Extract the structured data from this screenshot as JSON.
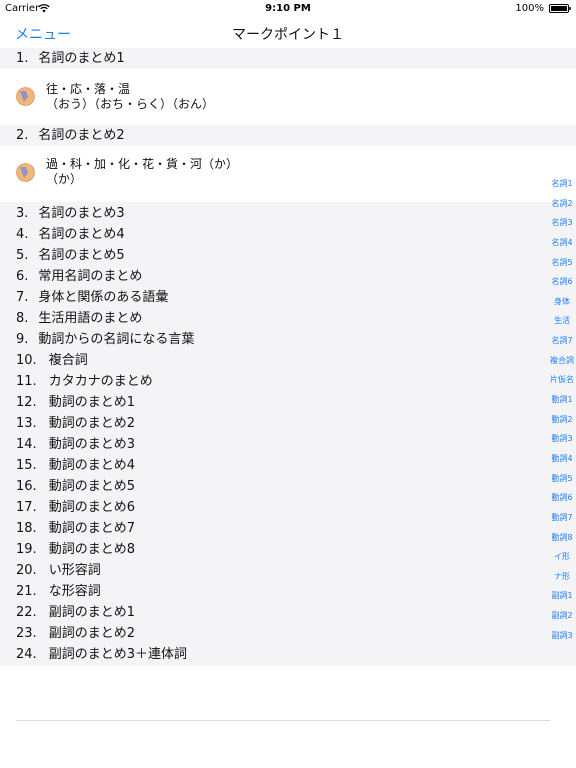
{
  "status_bar": {
    "carrier": "Carrier",
    "time": "9:10 PM",
    "battery_percent": "100%",
    "battery_level": 1.0
  },
  "nav": {
    "menu_label": "メニュー",
    "title": "マークポイント１"
  },
  "colors": {
    "accent": "#1a7ef5",
    "section_bg": "#f4f4f6",
    "icon": "#f2b57a",
    "icon_accent": "#8a8fcf"
  },
  "sections": [
    {
      "num": "1.",
      "title": "名詞のまとめ1",
      "rows": [
        {
          "icon": "bookmark-circle-icon",
          "line1": "往・応・落・温",
          "line2": "（おう）（おち・らく）（おん）"
        }
      ]
    },
    {
      "num": "2.",
      "title": "名詞のまとめ2",
      "rows": [
        {
          "icon": "bookmark-circle-icon",
          "line1": "過・科・加・化・花・貨・河（か）",
          "line2": "（か）"
        }
      ]
    },
    {
      "num": "3.",
      "title": "名詞のまとめ3"
    },
    {
      "num": "4.",
      "title": "名詞のまとめ4"
    },
    {
      "num": "5.",
      "title": "名詞のまとめ5"
    },
    {
      "num": "6.",
      "title": "常用名詞のまとめ"
    },
    {
      "num": "7.",
      "title": "身体と関係のある語彙"
    },
    {
      "num": "8.",
      "title": "生活用語のまとめ"
    },
    {
      "num": "9.",
      "title": "動詞からの名詞になる言葉"
    },
    {
      "num": "10.",
      "title": "複合詞"
    },
    {
      "num": "11.",
      "title": "カタカナのまとめ"
    },
    {
      "num": "12.",
      "title": "動詞のまとめ1"
    },
    {
      "num": "13.",
      "title": "動詞のまとめ2"
    },
    {
      "num": "14.",
      "title": "動詞のまとめ3"
    },
    {
      "num": "15.",
      "title": "動詞のまとめ4"
    },
    {
      "num": "16.",
      "title": "動詞のまとめ5"
    },
    {
      "num": "17.",
      "title": "動詞のまとめ6"
    },
    {
      "num": "18.",
      "title": "動詞のまとめ7"
    },
    {
      "num": "19.",
      "title": "動詞のまとめ8"
    },
    {
      "num": "20.",
      "title": "い形容詞"
    },
    {
      "num": "21.",
      "title": "な形容詞"
    },
    {
      "num": "22.",
      "title": "副詞のまとめ1"
    },
    {
      "num": "23.",
      "title": "副詞のまとめ2"
    },
    {
      "num": "24.",
      "title": "副詞のまとめ3＋連体詞"
    }
  ],
  "index": [
    "名詞1",
    "名詞2",
    "名詞3",
    "名詞4",
    "名詞5",
    "名詞6",
    "身体",
    "生活",
    "名詞7",
    "複合詞",
    "片仮名",
    "動詞1",
    "動詞2",
    "動詞3",
    "動詞4",
    "動詞5",
    "動詞6",
    "動詞7",
    "動詞8",
    "イ形",
    "ナ形",
    "副詞1",
    "副詞2",
    "副詞3"
  ]
}
